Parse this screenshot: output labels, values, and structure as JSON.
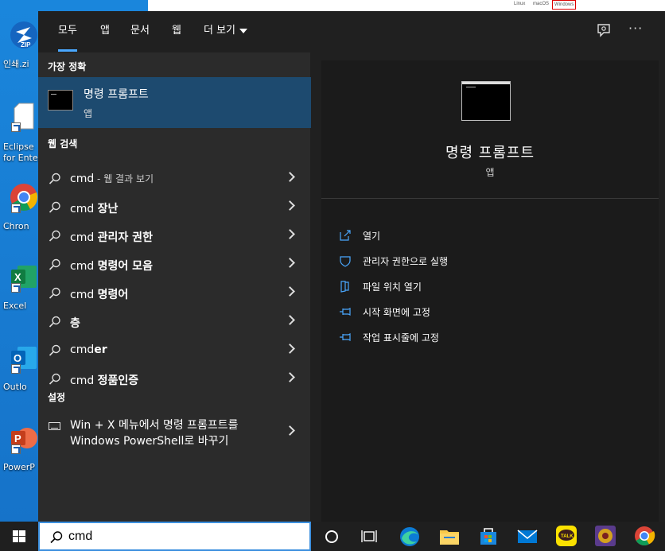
{
  "desktop": {
    "icons": [
      {
        "label": "인쇄.zi",
        "icon": "zip-icon"
      },
      {
        "label": "Eclipse",
        "label2": "for Enter",
        "icon": "document-icon"
      },
      {
        "label": "Chron",
        "icon": "chrome-icon"
      },
      {
        "label": "Excel",
        "icon": "excel-icon"
      },
      {
        "label": "Outlo",
        "icon": "outlook-icon"
      },
      {
        "label": "PowerP",
        "icon": "powerpoint-icon"
      }
    ],
    "bg_window_tabs": [
      "Linux",
      "macOS",
      "Windows"
    ]
  },
  "search": {
    "tabs": [
      "모두",
      "앱",
      "문서",
      "웹",
      "더 보기"
    ],
    "best_match": {
      "section": "가장 정확",
      "name": "명령 프롬프트",
      "type": "앱"
    },
    "web": {
      "section": "웹 검색",
      "items": [
        {
          "prefix": "cmd",
          "bold": "",
          "suffix": " - 웹 결과 보기"
        },
        {
          "prefix": "cmd ",
          "bold": "장난",
          "suffix": ""
        },
        {
          "prefix": "cmd ",
          "bold": "관리자 권한",
          "suffix": ""
        },
        {
          "prefix": "cmd ",
          "bold": "명령어 모음",
          "suffix": ""
        },
        {
          "prefix": "cmd ",
          "bold": "명령어",
          "suffix": ""
        },
        {
          "prefix": "",
          "bold": "층",
          "suffix": ""
        },
        {
          "prefix": "cmd",
          "bold": "er",
          "suffix": ""
        },
        {
          "prefix": "cmd ",
          "bold": "정품인증",
          "suffix": ""
        }
      ]
    },
    "settings": {
      "section": "설정",
      "line1": "Win + X 메뉴에서 명령 프롬프트를",
      "line2": "Windows PowerShell로 바꾸기"
    },
    "preview": {
      "name": "명령 프롬프트",
      "type": "앱",
      "actions": [
        {
          "label": "열기",
          "icon": "open-icon"
        },
        {
          "label": "관리자 권한으로 실행",
          "icon": "shield-icon"
        },
        {
          "label": "파일 위치 열기",
          "icon": "file-location-icon"
        },
        {
          "label": "시작 화면에 고정",
          "icon": "pin-icon"
        },
        {
          "label": "작업 표시줄에 고정",
          "icon": "pin-icon"
        }
      ]
    }
  },
  "taskbar": {
    "search_value": "cmd",
    "apps": [
      "cortana-icon",
      "task-view-icon",
      "edge-icon",
      "file-explorer-icon",
      "store-icon",
      "mail-icon",
      "kakaotalk-icon",
      "game-icon",
      "chrome-icon"
    ]
  },
  "colors": {
    "accent": "#4aa8ff",
    "selected_row": "#1d4a6f",
    "panel": "#2b2b2b",
    "preview": "#1b1b1b"
  }
}
